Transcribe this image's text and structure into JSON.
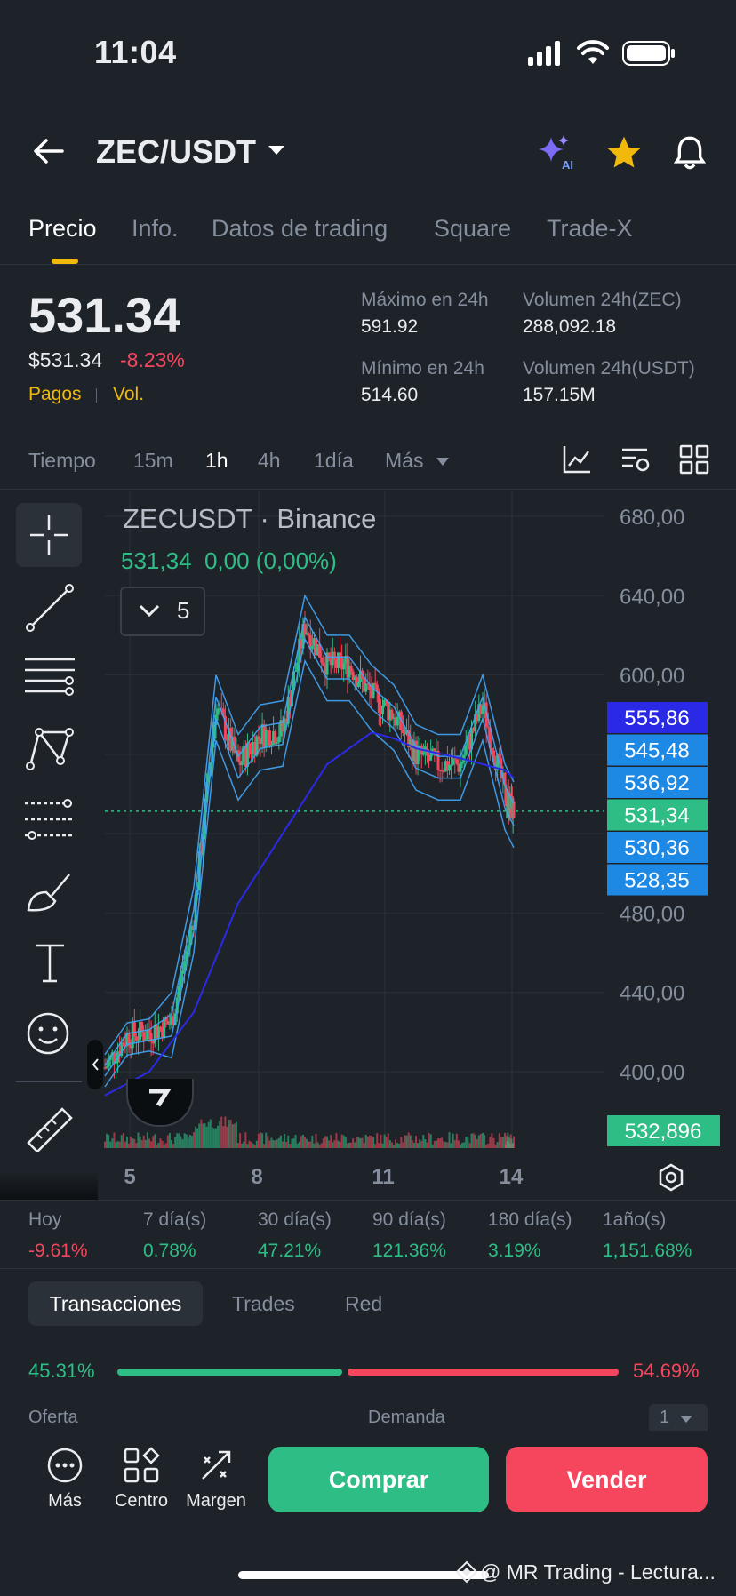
{
  "status": {
    "time": "11:04"
  },
  "header": {
    "pair": "ZEC/USDT",
    "ai_badge": "AI"
  },
  "tabs": [
    "Precio",
    "Info.",
    "Datos de trading",
    "Square",
    "Trade-X"
  ],
  "price": {
    "last": "531.34",
    "usd": "$531.34",
    "change": "-8.23%",
    "link1": "Pagos",
    "link2": "Vol.",
    "high_label": "Máximo en 24h",
    "high_value": "591.92",
    "vol_zec_label": "Volumen 24h(ZEC)",
    "vol_zec_value": "288,092.18",
    "low_label": "Mínimo en 24h",
    "low_value": "514.60",
    "vol_usdt_label": "Volumen 24h(USDT)",
    "vol_usdt_value": "157.15M"
  },
  "timeframes": {
    "items": [
      "Tiempo",
      "15m",
      "1h",
      "4h",
      "1día",
      "Más"
    ],
    "active": "1h"
  },
  "chart": {
    "title": "ZECUSDT · Binance",
    "ohlc_line": "531,34  0,00 (0,00%)",
    "indicator_count": "5",
    "volume_badge": "532,896",
    "y_ticks": [
      "680,00",
      "640,00",
      "600,00",
      "480,00",
      "440,00",
      "400,00"
    ],
    "x_ticks": [
      "5",
      "8",
      "11",
      "14"
    ],
    "price_badges": [
      {
        "value": "555,86",
        "color": "#2a2ae6"
      },
      {
        "value": "545,48",
        "color": "#1e88e5"
      },
      {
        "value": "536,92",
        "color": "#1e88e5"
      },
      {
        "value": "531,34",
        "color": "#2ebd85"
      },
      {
        "value": "530,36",
        "color": "#1e88e5"
      },
      {
        "value": "528,35",
        "color": "#1e88e5"
      }
    ],
    "colors": {
      "up": "#2ebd85",
      "down": "#f6465d",
      "ma_light": "#42a5f5",
      "ma_dark": "#2a2ae6"
    }
  },
  "chart_data": {
    "type": "line",
    "title": "ZECUSDT · Binance",
    "x_ticks": [
      "5",
      "8",
      "11",
      "14"
    ],
    "ylim": [
      400,
      680
    ],
    "series": [
      {
        "x": [
          0,
          0.5,
          1,
          1.5,
          2,
          2.5,
          3,
          3.5,
          4,
          4.5,
          5,
          5.5,
          6,
          6.5,
          7,
          7.5,
          8,
          8.5,
          9,
          9.2
        ],
        "values": [
          402,
          418,
          420,
          425,
          478,
          585,
          555,
          570,
          572,
          625,
          605,
          605,
          590,
          580,
          560,
          555,
          555,
          585,
          540,
          531
        ]
      },
      {
        "x": [
          0,
          1,
          2,
          3,
          4,
          5,
          6,
          6.5,
          7,
          8,
          9,
          9.2
        ],
        "values": [
          388,
          400,
          430,
          485,
          520,
          555,
          571,
          568,
          563,
          558,
          552,
          548
        ]
      }
    ]
  },
  "periods": [
    {
      "label": "Hoy",
      "value": "-9.61%",
      "color": "#f6465d"
    },
    {
      "label": "7 día(s)",
      "value": "0.78%",
      "color": "#2ebd85"
    },
    {
      "label": "30 día(s)",
      "value": "47.21%",
      "color": "#2ebd85"
    },
    {
      "label": "90 día(s)",
      "value": "121.36%",
      "color": "#2ebd85"
    },
    {
      "label": "180 día(s)",
      "value": "3.19%",
      "color": "#2ebd85"
    },
    {
      "label": "1año(s)",
      "value": "1,151.68%",
      "color": "#2ebd85"
    }
  ],
  "orderbook": {
    "tabs": [
      "Transacciones",
      "Trades",
      "Red"
    ],
    "buy_pct": "45.31%",
    "sell_pct": "54.69%",
    "buy_ratio": 0.4531,
    "bid_label": "Oferta",
    "ask_label": "Demanda",
    "depth": "1"
  },
  "bottom": {
    "more": "Más",
    "center": "Centro",
    "margin": "Margen",
    "buy": "Comprar",
    "sell": "Vender",
    "watermark": "@ MR Trading - Lectura..."
  }
}
